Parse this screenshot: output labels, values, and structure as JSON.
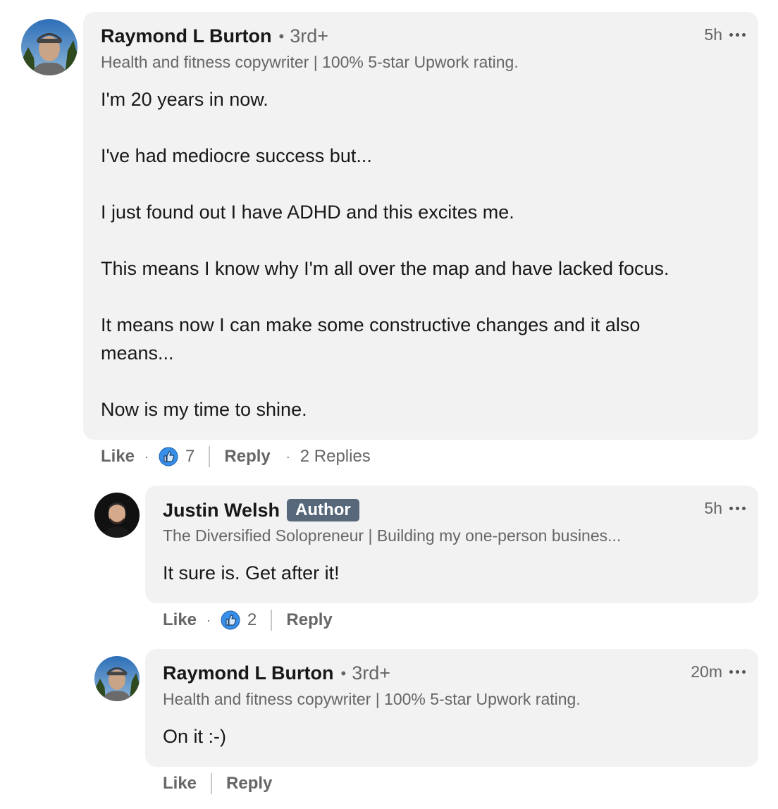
{
  "comments": [
    {
      "author": "Raymond L Burton",
      "degree": "3rd+",
      "headline": "Health and fitness copywriter | 100% 5-star Upwork rating.",
      "time": "5h",
      "paragraphs": [
        "I'm 20 years in now.",
        "I've had mediocre success but...",
        "I just found out I have ADHD and this excites me.",
        "This means I know why I'm all over the map and have lacked focus.",
        "It means now I can make some constructive changes and it also means...",
        "Now is my time to shine."
      ],
      "like_label": "Like",
      "reaction_count": "7",
      "reply_label": "Reply",
      "replies_label": "2 Replies"
    },
    {
      "author": "Justin Welsh",
      "badge": "Author",
      "headline": "The Diversified Solopreneur | Building my one-person busines...",
      "time": "5h",
      "paragraphs": [
        "It sure is. Get after it!"
      ],
      "like_label": "Like",
      "reaction_count": "2",
      "reply_label": "Reply"
    },
    {
      "author": "Raymond L Burton",
      "degree": "3rd+",
      "headline": "Health and fitness copywriter | 100% 5-star Upwork rating.",
      "time": "20m",
      "paragraphs": [
        "On it :-)"
      ],
      "like_label": "Like",
      "reply_label": "Reply"
    }
  ],
  "colors": {
    "bubble": "#f2f2f2",
    "author_badge": "#56687a",
    "like_icon_blue": "#378fe9"
  }
}
